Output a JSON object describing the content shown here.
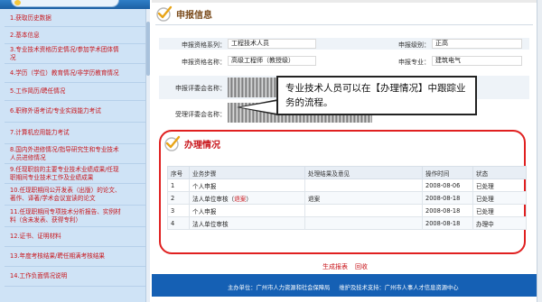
{
  "sidebar": {
    "items": [
      {
        "lines": [
          "1.获取历史数据"
        ]
      },
      {
        "lines": [
          "2.基本信息"
        ]
      },
      {
        "lines": [
          "3.专业技术资格历史情况/参加学术团体情",
          "况"
        ]
      },
      {
        "lines": [
          "4.学历（学位）教育情况/非学历教育情况"
        ]
      },
      {
        "lines": [
          "5.工作简历/聘任情况"
        ]
      },
      {
        "lines": [
          "6.职称外语考试/专业实践能力考试"
        ]
      },
      {
        "lines": [
          "7.计算机应用能力考试"
        ]
      },
      {
        "lines": [
          "8.国内外进修情况/指导研究生和专业技术",
          "人员进修情况"
        ]
      },
      {
        "lines": [
          "9.任现职前的主要专业技术业绩成果/任现",
          "职期间专业技术工作及业绩成果"
        ]
      },
      {
        "lines": [
          "10.任现职期间公开发表（出版）的论文、",
          "著作、译著/学术会议宣读的论文"
        ]
      },
      {
        "lines": [
          "11.任现职期间专项技术分析报告、实例材",
          "料（含未发表、获得专利）"
        ]
      },
      {
        "lines": [
          "12.证书、证明材料"
        ]
      },
      {
        "lines": [
          "13.年度考核结果/聘任期满考核结果"
        ]
      },
      {
        "lines": [
          "14.工作负面情况说明"
        ]
      }
    ]
  },
  "main": {
    "section1_title": "申报信息",
    "fields": {
      "qual_series_label": "申报资格系列：",
      "qual_series_value": "工程技术人员",
      "qual_level_label": "申报级别：",
      "qual_level_value": "正高",
      "qual_name_label": "申报资格名称：",
      "qual_name_value": "高级工程师（教授级）",
      "specialty_label": "申报专业：",
      "specialty_value": "建筑电气",
      "review_committee_label": "申报评委会名称：",
      "accept_committee_label": "受理评委会名称："
    },
    "callout": "专业技术人员可以在【办理情况】中跟踪业务的流程。",
    "section2_title": "办理情况",
    "table": {
      "headers": [
        "序号",
        "业务步骤",
        "处理结果及意见",
        "操作时间",
        "状态"
      ],
      "rows": [
        {
          "no": "1",
          "step": "个人申报",
          "step_note": "",
          "result": "",
          "time": "2008-08-06",
          "status": "已处理"
        },
        {
          "no": "2",
          "step": "法人单位审核（",
          "step_note": "退案",
          "step_end": "）",
          "result": "退案",
          "time": "2008-08-18",
          "status": "已处理"
        },
        {
          "no": "3",
          "step": "个人申报",
          "step_note": "",
          "result": "",
          "time": "2008-08-18",
          "status": "已处理"
        },
        {
          "no": "4",
          "step": "法人单位审核",
          "step_note": "",
          "result": "",
          "time": "2008-08-18",
          "status": "办理中"
        }
      ]
    },
    "footer_links": {
      "generate": "生成报表",
      "back": "回收"
    },
    "footer": {
      "host": "主办单位：广州市人力资源和社会保障局",
      "support": "维护及技术支持：广州市人事人才信息资源中心"
    }
  },
  "colors": {
    "accent_red": "#c8141a",
    "footer_blue": "#1560b4",
    "sidebar_bg": "#cfe3f6"
  }
}
